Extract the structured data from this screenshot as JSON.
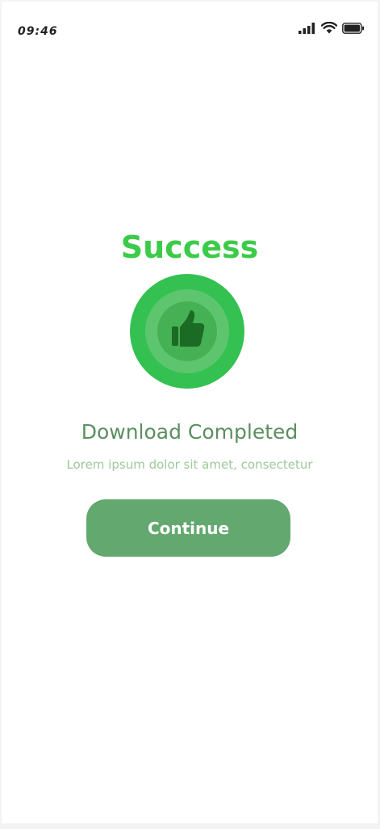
{
  "status_bar": {
    "time": "09:46",
    "icons": [
      "signal-icon",
      "wifi-icon",
      "battery-icon"
    ]
  },
  "main": {
    "title": "Success",
    "badge_icon": "thumbs-up-icon",
    "headline": "Download Completed",
    "subtitle": "Lorem ipsum dolor sit amet, consectetur",
    "continue_label": "Continue"
  },
  "colors": {
    "title_green": "#3ccb48",
    "badge_outer": "#34c151",
    "badge_middle": "#5ec56f",
    "badge_inner": "#46b055",
    "thumb": "#1c6b25",
    "headline": "#5b8f5f",
    "subtitle": "#9cc99b",
    "button": "#63a86f",
    "button_text": "#ffffff"
  }
}
